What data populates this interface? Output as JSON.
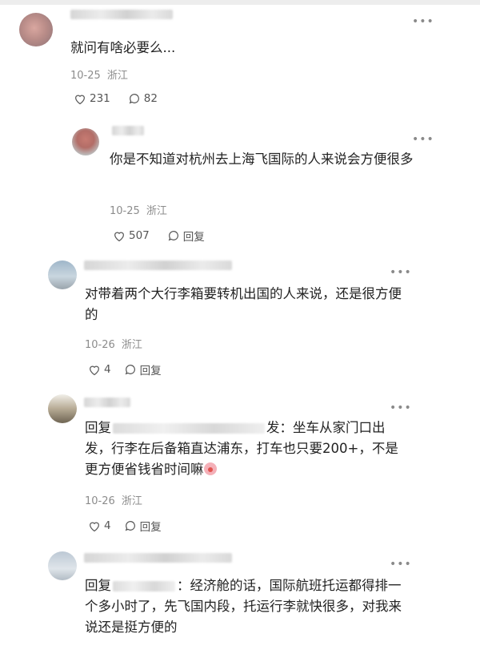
{
  "comments": [
    {
      "text": "就问有啥必要么...",
      "date": "10-25",
      "location": "浙江",
      "likes": "231",
      "replies": "82"
    },
    {
      "text": "你是不知道对杭州去上海飞国际的人来说会方便很多",
      "date": "10-25",
      "location": "浙江",
      "likes": "507",
      "reply_label": "回复"
    },
    {
      "text": "对带着两个大行李箱要转机出国的人来说，还是很方便的",
      "date": "10-26",
      "location": "浙江",
      "likes": "4",
      "reply_label": "回复"
    },
    {
      "reply_prefix": "回复",
      "text_after": "发：坐车从家门口出发，行李在后备箱直达浦东，打车也只要200+，不是更方便省钱省时间嘛",
      "date": "10-26",
      "location": "浙江",
      "likes": "4",
      "reply_label": "回复"
    },
    {
      "reply_prefix": "回复",
      "text_after": "：经济舱的话，国际航班托运都得排一个多小时了，先飞国内段，托运行李就快很多，对我来说还是挺方便的"
    }
  ],
  "more_icon": "more-dots-icon",
  "like_icon": "heart-outline-icon",
  "reply_icon": "comment-bubble-icon"
}
